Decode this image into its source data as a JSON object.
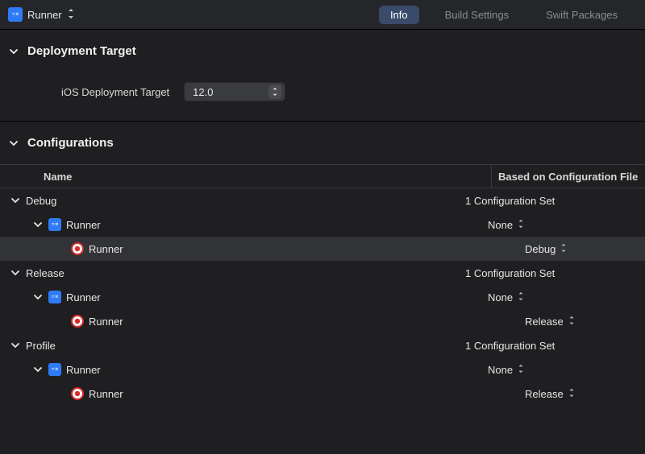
{
  "topbar": {
    "project_name": "Runner",
    "tabs": {
      "info": "Info",
      "build_settings": "Build Settings",
      "swift_packages": "Swift Packages"
    }
  },
  "sections": {
    "deployment_target": {
      "title": "Deployment Target",
      "field_label": "iOS Deployment Target",
      "value": "12.0"
    },
    "configurations": {
      "title": "Configurations",
      "columns": {
        "name": "Name",
        "based_on": "Based on Configuration File"
      },
      "groups": [
        {
          "name": "Debug",
          "summary": "1 Configuration Set",
          "project": {
            "name": "Runner",
            "config": "None"
          },
          "target": {
            "name": "Runner",
            "config": "Debug"
          }
        },
        {
          "name": "Release",
          "summary": "1 Configuration Set",
          "project": {
            "name": "Runner",
            "config": "None"
          },
          "target": {
            "name": "Runner",
            "config": "Release"
          }
        },
        {
          "name": "Profile",
          "summary": "1 Configuration Set",
          "project": {
            "name": "Runner",
            "config": "None"
          },
          "target": {
            "name": "Runner",
            "config": "Release"
          }
        }
      ]
    }
  }
}
